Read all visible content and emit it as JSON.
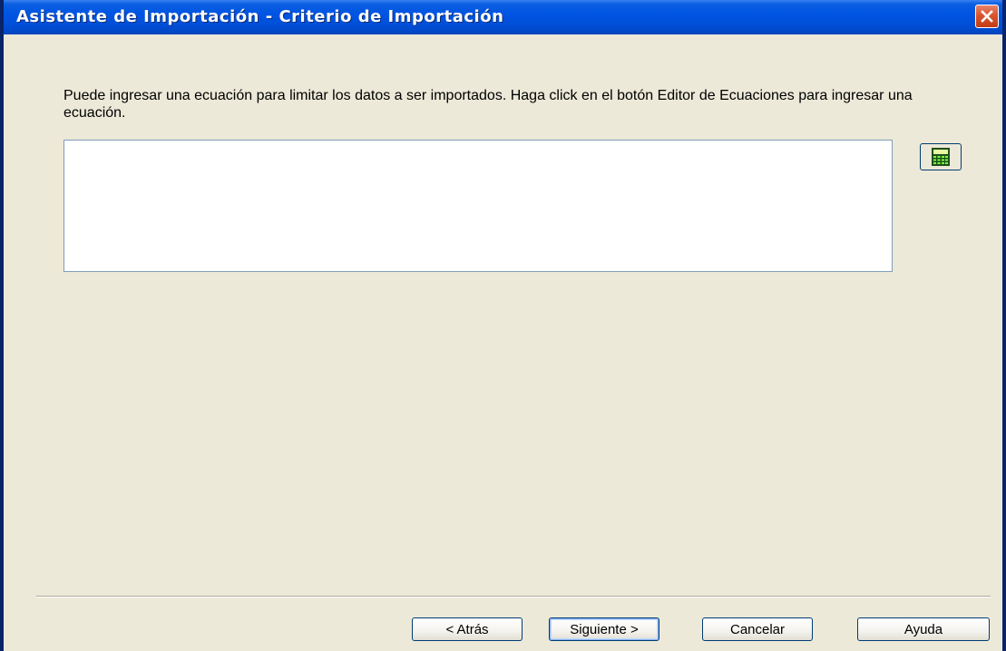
{
  "window": {
    "title": "Asistente de Importación - Criterio de Importación"
  },
  "content": {
    "instructions": "Puede ingresar una ecuación para limitar los datos a ser importados. Haga click en el botón Editor de Ecuaciones para ingresar una ecuación.",
    "equation_value": "",
    "equation_editor_icon": "calculator-icon"
  },
  "footer": {
    "back_label": "< Atrás",
    "next_label": "Siguiente >",
    "cancel_label": "Cancelar",
    "help_label": "Ayuda"
  },
  "colors": {
    "titlebar": "#0054E3",
    "background": "#ECE9D8",
    "close_button": "#D9552E",
    "input_border": "#7F9DB9",
    "button_border": "#003C74"
  }
}
